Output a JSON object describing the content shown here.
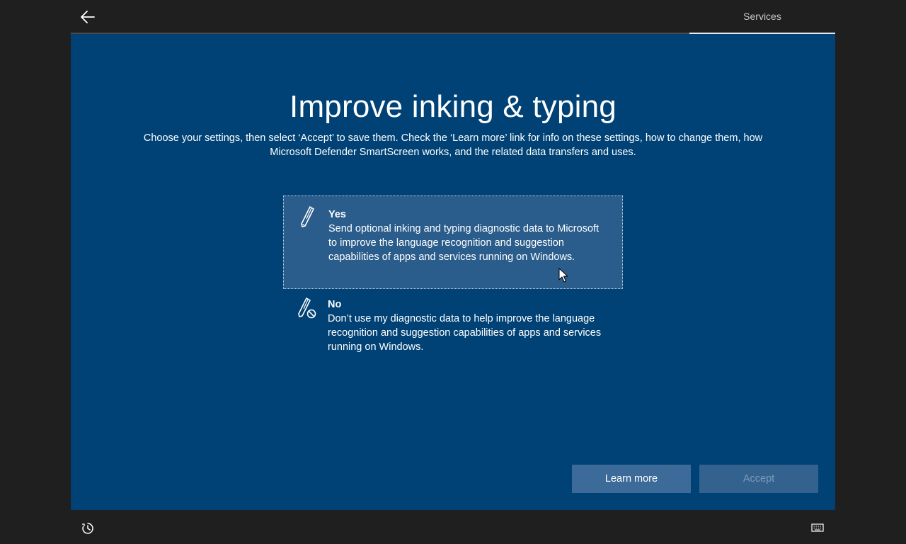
{
  "header": {
    "back_icon": "back-arrow-icon",
    "section_tab": "Services"
  },
  "main": {
    "title": "Improve inking & typing",
    "subtitle": "Choose your settings, then select ‘Accept’ to save them. Check the ‘Learn more’ link for info on these settings, how to change them, how Microsoft Defender SmartScreen works, and the related data transfers and uses.",
    "options": [
      {
        "icon": "pen-icon",
        "title": "Yes",
        "description": "Send optional inking and typing diagnostic data to Microsoft to improve the language recognition and suggestion capabilities of apps and services running on Windows.",
        "selected": true
      },
      {
        "icon": "pen-blocked-icon",
        "title": "No",
        "description": "Don’t use my diagnostic data to help improve the language recognition and suggestion capabilities of apps and services running on Windows.",
        "selected": false
      }
    ],
    "learn_more_label": "Learn more",
    "accept_label": "Accept"
  },
  "footer": {
    "ease_of_access_icon": "ease-of-access-icon",
    "keyboard_icon": "keyboard-icon"
  },
  "colors": {
    "panel_bg": "#004275",
    "chrome_bg": "#1f1f1f",
    "selected_option_bg": "#2a5d8c",
    "learn_more_bg": "#3d6b99",
    "accept_disabled_bg": "#33628f"
  }
}
